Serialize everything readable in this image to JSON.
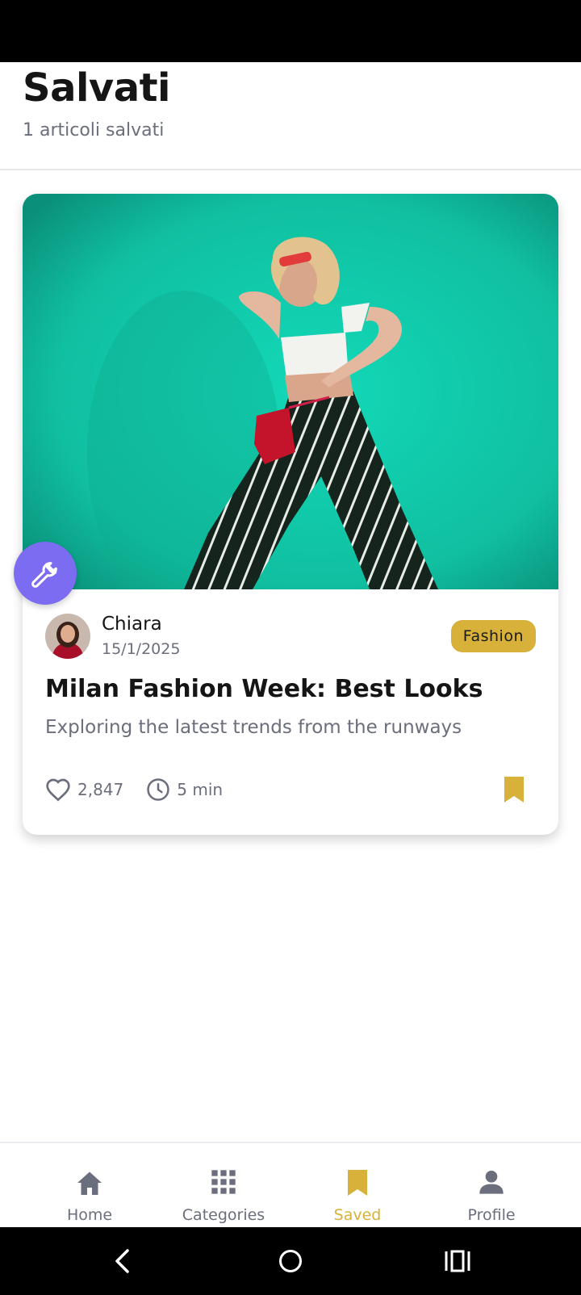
{
  "header": {
    "title": "Salvati",
    "subtitle": "1 articoli salvati"
  },
  "article": {
    "author": "Chiara",
    "date": "15/1/2025",
    "category": "Fashion",
    "title": "Milan Fashion Week: Best Looks",
    "excerpt": "Exploring the latest trends from the runways",
    "likes": "2,847",
    "read_time": "5 min",
    "saved": true
  },
  "fab": {
    "icon": "wrench-icon"
  },
  "bottom_nav": {
    "items": [
      {
        "label": "Home",
        "icon": "home-icon",
        "active": false
      },
      {
        "label": "Categories",
        "icon": "grid-icon",
        "active": false
      },
      {
        "label": "Saved",
        "icon": "bookmark-icon",
        "active": true
      },
      {
        "label": "Profile",
        "icon": "person-icon",
        "active": false
      }
    ]
  },
  "colors": {
    "accent": "#d7b13a",
    "fab": "#7c6cf2",
    "image_background": "#13c9a9",
    "muted_text": "#6b6e7c"
  }
}
